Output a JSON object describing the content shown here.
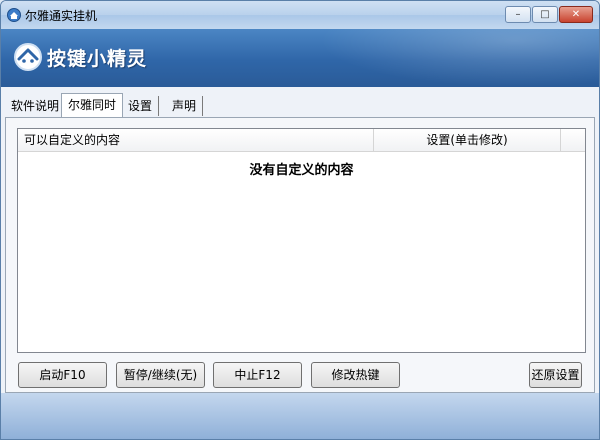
{
  "window": {
    "title": "尔雅通实挂机",
    "minimize_label": "–",
    "maximize_label": "□",
    "close_label": "✕"
  },
  "banner": {
    "logo_text": "按键小精灵"
  },
  "tabs": [
    {
      "label": "软件说明"
    },
    {
      "label": "尔雅同时"
    },
    {
      "label": "设置"
    },
    {
      "label": "声明"
    }
  ],
  "active_tab": "尔雅同时",
  "list": {
    "columns": [
      {
        "label": "可以自定义的内容"
      },
      {
        "label": "设置(单击修改)"
      }
    ],
    "empty_message": "没有自定义的内容"
  },
  "buttons": {
    "start": "启动F10",
    "pause": "暂停/继续(无)",
    "stop": "中止F12",
    "hotkey": "修改热键",
    "reset": "还原设置"
  }
}
